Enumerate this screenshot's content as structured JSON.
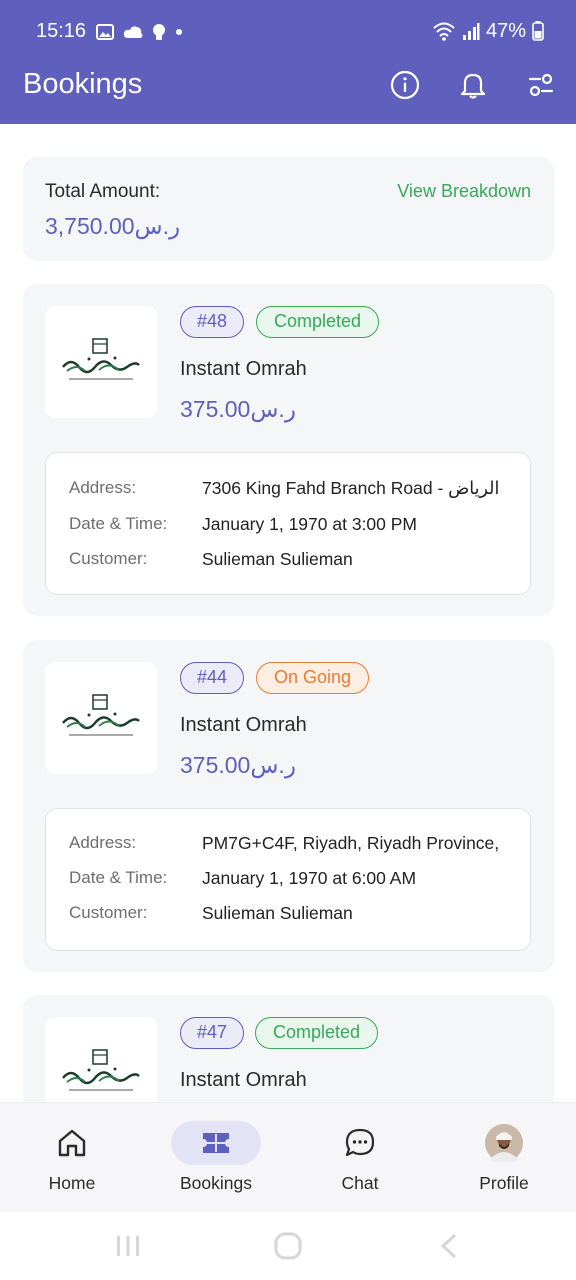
{
  "status_bar": {
    "time": "15:16",
    "battery": "47%"
  },
  "header": {
    "title": "Bookings",
    "icons": [
      "info-icon",
      "bell-icon",
      "filter-icon"
    ]
  },
  "summary": {
    "label": "Total Amount:",
    "value": "3,750.00ر.س",
    "action": "View Breakdown"
  },
  "bookings": [
    {
      "id": "#48",
      "status": "Completed",
      "service": "Instant Omrah",
      "price": "375.00ر.س",
      "address_label": "Address:",
      "address": "7306 King Fahd Branch Road - الرياض",
      "datetime_label": "Date & Time:",
      "datetime": "January 1, 1970 at 3:00 PM",
      "customer_label": "Customer:",
      "customer": "Sulieman Sulieman"
    },
    {
      "id": "#44",
      "status": "On Going",
      "service": "Instant Omrah",
      "price": "375.00ر.س",
      "address_label": "Address:",
      "address": "PM7G+C4F, Riyadh, Riyadh Province,",
      "datetime_label": "Date & Time:",
      "datetime": "January 1, 1970 at 6:00 AM",
      "customer_label": "Customer:",
      "customer": "Sulieman Sulieman"
    },
    {
      "id": "#47",
      "status": "Completed",
      "service": "Instant Omrah"
    }
  ],
  "bottom_nav": {
    "items": [
      {
        "label": "Home",
        "icon": "home-icon"
      },
      {
        "label": "Bookings",
        "icon": "ticket-icon"
      },
      {
        "label": "Chat",
        "icon": "chat-icon"
      },
      {
        "label": "Profile",
        "icon": "avatar"
      }
    ],
    "active": "Bookings"
  },
  "colors": {
    "primary": "#5f5fbd",
    "success": "#38a85a",
    "warning": "#ee7a30"
  }
}
